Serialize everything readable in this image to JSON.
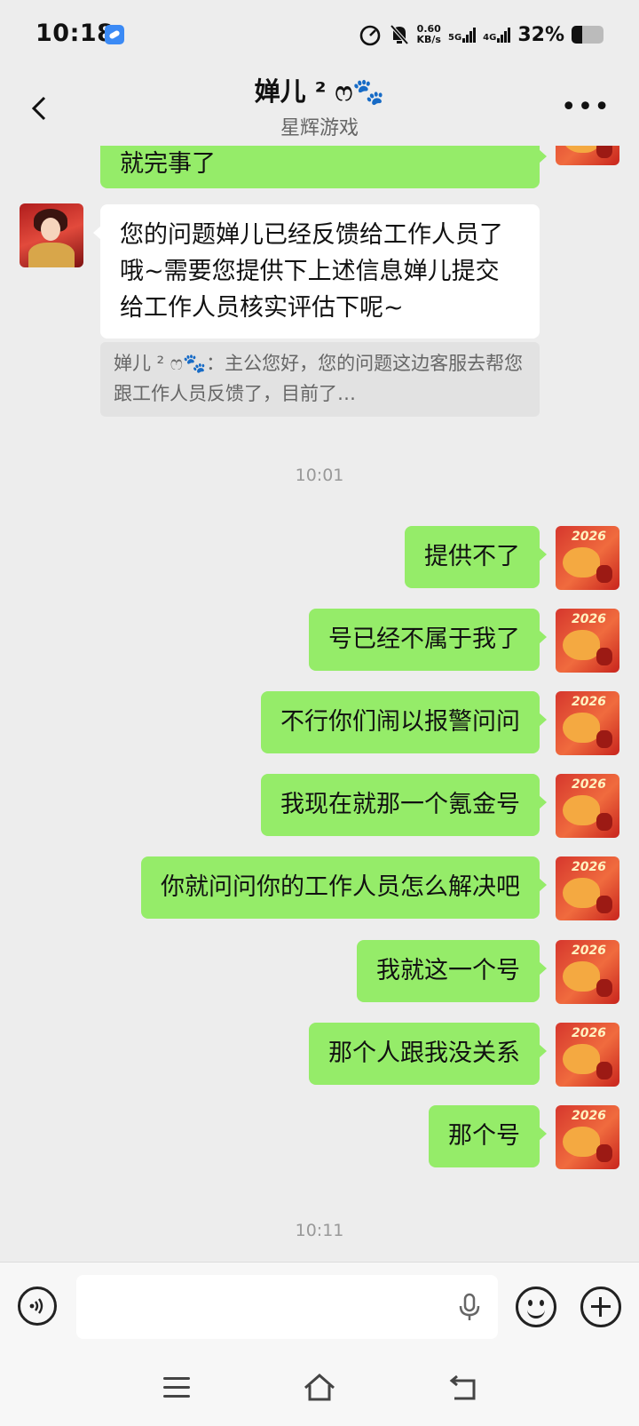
{
  "status_bar": {
    "time": "10:18",
    "net_speed_value": "0.60",
    "net_speed_unit": "KB/s",
    "signal1_label": "5G",
    "signal2_label": "4G",
    "battery_text": "32%",
    "battery_level": 0.32
  },
  "header": {
    "title": "婵儿 ² ෆ🐾",
    "subtitle": "星辉游戏",
    "more": "•••"
  },
  "messages": {
    "m0": "就完事了",
    "m1": "您的问题婵儿已经反馈给工作人员了哦~需要您提供下上述信息婵儿提交给工作人员核实评估下呢~",
    "quote": "婵儿 ² ෆ🐾：主公您好，您的问题这边客服去帮您跟工作人员反馈了，目前了…",
    "time1": "10:01",
    "m2": "提供不了",
    "m3": "号已经不属于我了",
    "m4": "不行你们闹以报警问问",
    "m5": "我现在就那一个氪金号",
    "m6": "你就问问你的工作人员怎么解决吧",
    "m7": "我就这一个号",
    "m8": "那个人跟我没关系",
    "m9": "那个号",
    "time2": "10:11"
  },
  "avatar_text": "2026",
  "input": {
    "value": "",
    "placeholder": ""
  },
  "icons": [
    "back-icon",
    "more-icon",
    "voice-icon",
    "mic-icon",
    "emoji-icon",
    "plus-icon",
    "menu-icon",
    "home-icon",
    "return-icon"
  ]
}
